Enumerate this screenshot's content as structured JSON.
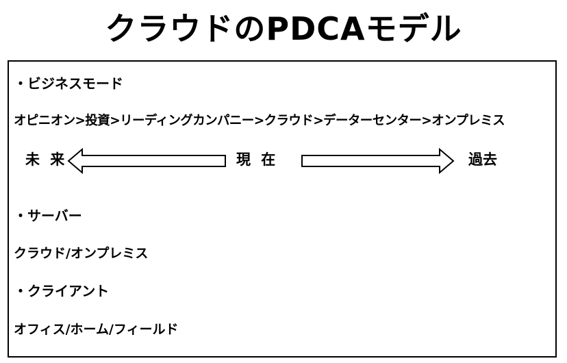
{
  "title": "クラウドのPDCAモデル",
  "sections": {
    "business": {
      "heading": "・ビジネスモード",
      "chain": "オピニオン>投資>リーディングカンパニー>クラウド>データーセンター>オンプレミス"
    },
    "timeline": {
      "future": "未 来",
      "present": "現 在",
      "past": "過去"
    },
    "server": {
      "heading": "・サーバー",
      "value": "クラウド/オンプレミス"
    },
    "client": {
      "heading": "・クライアント",
      "value": "オフィス/ホーム/フィールド"
    }
  }
}
